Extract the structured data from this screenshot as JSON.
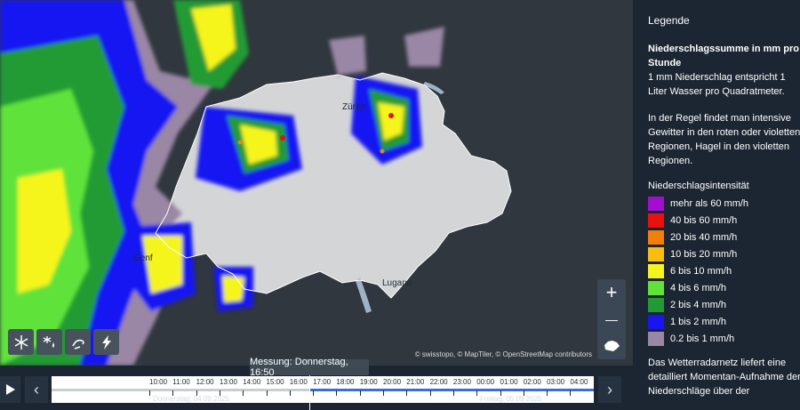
{
  "map": {
    "cities": [
      "Zürich",
      "Genf",
      "Lugano"
    ],
    "attribution": "© swisstopo, © MapTiler, © OpenStreetMap contributors",
    "controls": {
      "zoom_in": "+",
      "zoom_out": "—"
    }
  },
  "legend": {
    "title": "Legende",
    "heading": "Niederschlagssumme in mm pro Stunde",
    "subtext": "1 mm Niederschlag entspricht 1 Liter Wasser pro Quadratmeter.",
    "paragraph": "In der Regel findet man intensive Gewitter in den roten oder violetten Regionen, Hagel in den violetten Regionen.",
    "intensity_title": "Niederschlagsintensität",
    "items": [
      {
        "label": "mehr als 60 mm/h",
        "color": "#a20ed0"
      },
      {
        "label": "40 bis 60 mm/h",
        "color": "#e8110f"
      },
      {
        "label": "20 bis 40 mm/h",
        "color": "#f27f0a"
      },
      {
        "label": "10 bis 20 mm/h",
        "color": "#f9bd10"
      },
      {
        "label": "6 bis 10 mm/h",
        "color": "#f5f51e"
      },
      {
        "label": "4 bis 6 mm/h",
        "color": "#5fe33b"
      },
      {
        "label": "2 bis 4 mm/h",
        "color": "#229b34"
      },
      {
        "label": "1 bis 2 mm/h",
        "color": "#1914f2"
      },
      {
        "label": "0.2 bis 1 mm/h",
        "color": "#9a86a5"
      }
    ],
    "network_text": "Das Wetterradarnetz liefert eine detailliert Momentan-Aufnahme der Niederschläge über der"
  },
  "timeline": {
    "measurement": "Messung: Donnerstag, 16:50",
    "hours": [
      "10:00",
      "11:00",
      "12:00",
      "13:00",
      "14:00",
      "15:00",
      "16:00",
      "17:00",
      "18:00",
      "19:00",
      "20:00",
      "21:00",
      "22:00",
      "23:00",
      "00:00",
      "01:00",
      "02:00",
      "03:00",
      "04:00"
    ],
    "date_left": "Donnerstag, 04.09.2025",
    "date_right": "Freitag, 05.09.2025",
    "prev_icon": "chevron-left-icon",
    "next_icon": "chevron-right-icon",
    "play_icon": "play-icon",
    "colors": {
      "past": "#c8cdd3",
      "forecast": "#3a6ee0"
    }
  },
  "layers": [
    "snowflake-icon",
    "snow-rain-icon",
    "wind-icon",
    "lightning-icon"
  ]
}
